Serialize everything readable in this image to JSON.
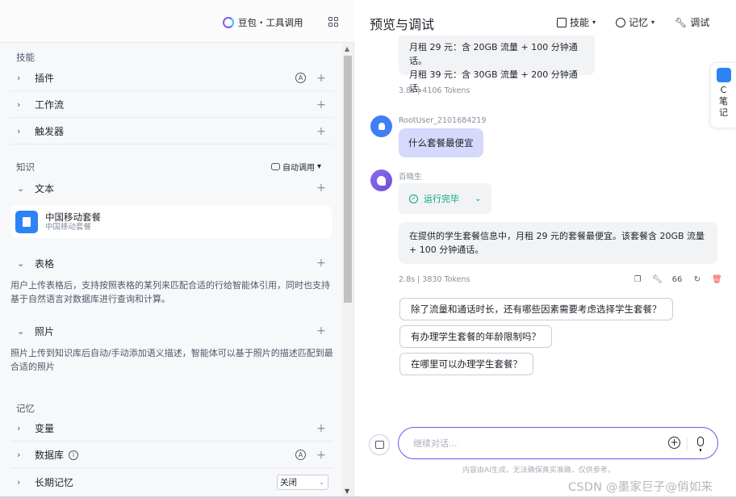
{
  "left": {
    "model_label": "豆包・工具调用",
    "skills_title": "技能",
    "skills": [
      {
        "label": "插件"
      },
      {
        "label": "工作流"
      },
      {
        "label": "触发器"
      }
    ],
    "knowledge_title": "知识",
    "auto_call_label": "自动调用",
    "text_label": "文本",
    "doc": {
      "name": "中国移动套餐",
      "sub": "中国移动套餐"
    },
    "table_label": "表格",
    "table_desc": "用户上传表格后，支持按照表格的某列来匹配合适的行给智能体引用，同时也支持基于自然语言对数据库进行查询和计算。",
    "photo_label": "照片",
    "photo_desc": "照片上传到知识库后自动/手动添加语义描述，智能体可以基于照片的描述匹配到最合适的照片",
    "memory_title": "记忆",
    "variables_label": "变量",
    "database_label": "数据库",
    "longterm_label": "长期记忆",
    "longterm_value": "关闭",
    "auto_badge": "A",
    "plus": "+",
    "chevron": "›",
    "chevron_open": "⌄"
  },
  "right": {
    "title": "预览与调试",
    "skills_btn": "技能",
    "memory_btn": "记忆",
    "debug_btn": "调试",
    "prev_bubble_lines": [
      "月租 29 元：含 20GB 流量 + 100 分钟通话。",
      "月租 39 元：含 30GB 流量 + 200 分钟通话。"
    ],
    "prev_meta": "3.8s  |  4106 Tokens",
    "user_name": "RootUser_2101684219",
    "user_msg": "什么套餐最便宜",
    "bot_name": "百晓生",
    "status": "运行完毕",
    "answer": "在提供的学生套餐信息中，月租 29 元的套餐最便宜。该套餐含 20GB 流量 + 100 分钟通话。",
    "answer_meta": "2.8s  |  3830 Tokens",
    "quote_icon": "66",
    "suggestions": [
      "除了流量和通话时长，还有哪些因素需要考虑选择学生套餐？",
      "有办理学生套餐的年龄限制吗？",
      "在哪里可以办理学生套餐？"
    ],
    "input_placeholder": "继续对话...",
    "disclaimer": "内容由AI生成，无法确保真实准确，仅供参考。"
  },
  "side_note": {
    "letters": [
      "C",
      "笔",
      "记"
    ]
  },
  "watermark": "CSDN @墨家巨子@俏如来"
}
